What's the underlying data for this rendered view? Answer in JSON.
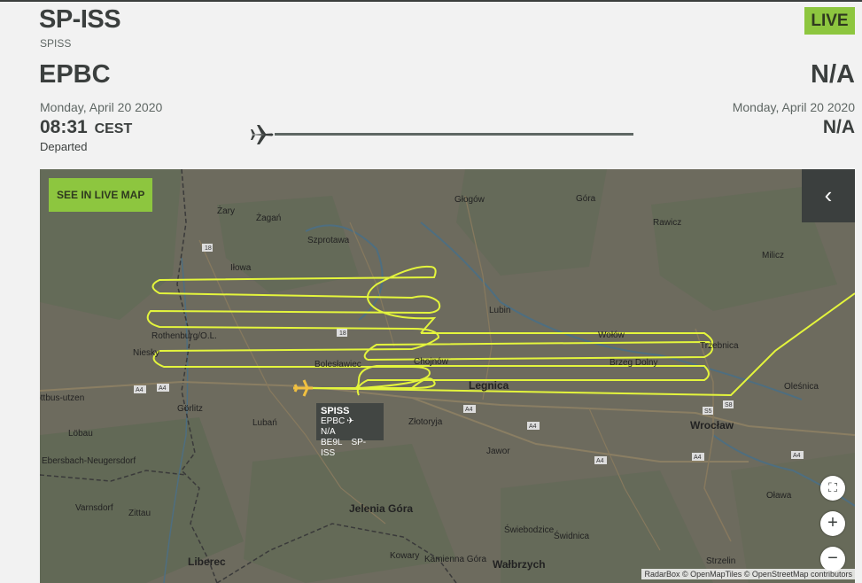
{
  "header": {
    "registration": "SP-ISS",
    "callsign": "SPISS",
    "live_label": "LIVE",
    "origin": "EPBC",
    "destination": "N/A",
    "origin_date": "Monday, April 20 2020",
    "destination_date": "Monday, April 20 2020",
    "departure_time": "08:31",
    "departure_tz": "CEST",
    "arrival_time": "N/A",
    "status": "Departed"
  },
  "map": {
    "see_live_label": "SEE IN LIVE MAP",
    "collapse_icon": "chevron-left-icon",
    "fullscreen_icon": "fullscreen-icon",
    "zoom_in_label": "+",
    "zoom_out_label": "−",
    "attribution": "RadarBox © OpenMapTiles © OpenStreetMap contributors",
    "track_color": "#e4f53c",
    "tooltip": {
      "callsign": "SPISS",
      "route_from": "EPBC",
      "route_to": "N/A",
      "aircraft_type": "BE9L",
      "registration": "SP-ISS"
    },
    "places": [
      "Żary",
      "Żagań",
      "Szprotawa",
      "Głogów",
      "Góra",
      "Rawicz",
      "Milicz",
      "Iłowa",
      "Lubin",
      "Rothenburg/O.L.",
      "Wołów",
      "Trzebnica",
      "Niesky",
      "Bolesławiec",
      "Chojnów",
      "Brzeg Dolny",
      "Legnica",
      "Oleśnica",
      "Görlitz",
      "Lubań",
      "Złotoryja",
      "Wrocław",
      "Löbau",
      "Jawor",
      "Ebersbach-Neugersdorf",
      "Varnsdorf",
      "Zittau",
      "Jelenia Góra",
      "Oława",
      "Świebodzice",
      "Świdnica",
      "Strzelin",
      "Liberec",
      "Kowary",
      "Kamienna Góra",
      "Wałbrzych",
      "Cottbus-utzen"
    ],
    "roads": [
      "18",
      "18",
      "A4",
      "A4",
      "A4",
      "A4",
      "A4",
      "A4",
      "A4",
      "S5",
      "S8",
      "A4"
    ]
  }
}
